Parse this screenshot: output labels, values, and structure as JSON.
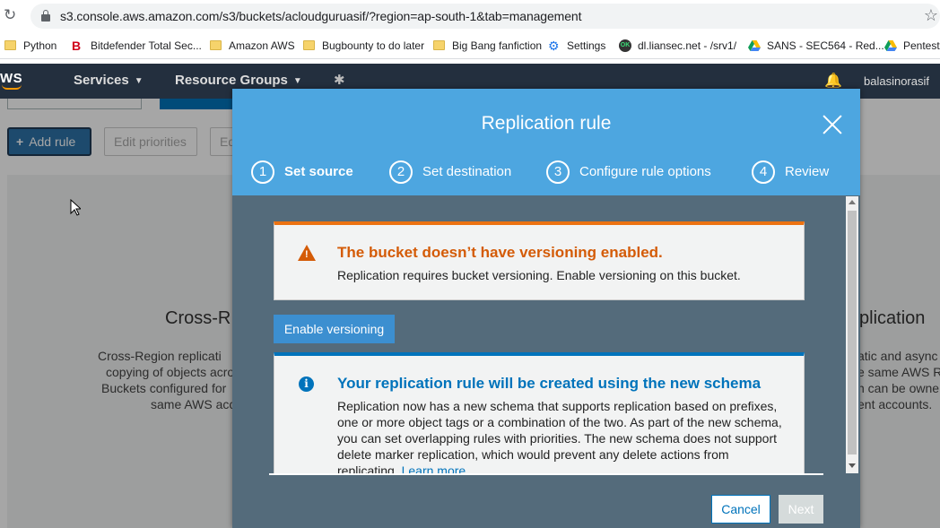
{
  "browser": {
    "url": "s3.console.aws.amazon.com/s3/buckets/acloudguruasif/?region=ap-south-1&tab=management",
    "bookmarks": [
      {
        "label": "Python",
        "icon": "folder-icon"
      },
      {
        "label": "Bitdefender Total Sec...",
        "icon": "bitdefender-icon"
      },
      {
        "label": "Amazon AWS",
        "icon": "folder-icon"
      },
      {
        "label": "Bugbounty to do later",
        "icon": "folder-icon"
      },
      {
        "label": "Big Bang fanfiction",
        "icon": "folder-icon"
      },
      {
        "label": "Settings",
        "icon": "gear-icon"
      },
      {
        "label": "dl.liansec.net - /srv1/",
        "icon": "ok-site-icon"
      },
      {
        "label": "SANS - SEC564 - Red...",
        "icon": "drive-icon"
      },
      {
        "label": "Pentester",
        "icon": "drive-icon"
      }
    ]
  },
  "aws_nav": {
    "logo": "WS",
    "services": "Services",
    "resource_groups": "Resource Groups",
    "user": "balasinorasif"
  },
  "background": {
    "add_rule": "Add rule",
    "edit_priorities": "Edit priorities",
    "edit_partial": "Ed",
    "card_title_left": "Cross-R",
    "card_title_right": "plication",
    "desc_left": [
      "Cross-Region replicati",
      "copying of objects acro",
      "Buckets configured for",
      "same AWS acc"
    ],
    "desc_right": [
      "atic and async",
      "e same AWS R",
      "n can be owne",
      "ent accounts."
    ]
  },
  "modal": {
    "title": "Replication rule",
    "steps": [
      {
        "num": "1",
        "label": "Set source",
        "active": true
      },
      {
        "num": "2",
        "label": "Set destination",
        "active": false
      },
      {
        "num": "3",
        "label": "Configure rule options",
        "active": false
      },
      {
        "num": "4",
        "label": "Review",
        "active": false
      }
    ],
    "warning": {
      "title": "The bucket doesn’t have versioning enabled.",
      "body": "Replication requires bucket versioning. Enable versioning on this bucket."
    },
    "enable_button": "Enable versioning",
    "info": {
      "title": "Your replication rule will be created using the new schema",
      "body": "Replication now has a new schema that supports replication based on prefixes, one or more object tags or a combination of the two. As part of the new schema, you can set overlapping rules with priorities. The new schema does not support delete marker replication, which would prevent any delete actions from replicating.",
      "link": "Learn more"
    },
    "cancel": "Cancel",
    "next": "Next"
  },
  "colors": {
    "modal_header": "#4da6e0",
    "modal_body": "#546b7b",
    "warning": "#d45b07",
    "info": "#0073bb",
    "aws_nav": "#232f3e"
  }
}
